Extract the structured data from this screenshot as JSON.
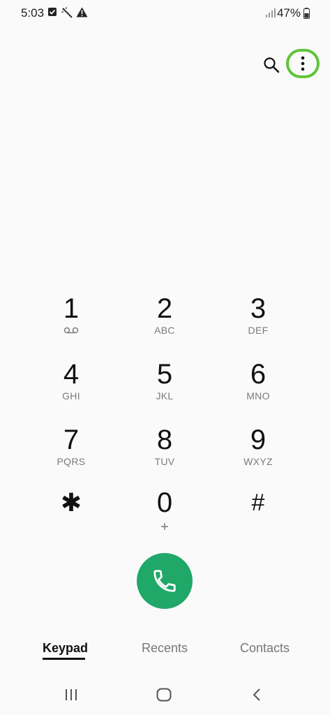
{
  "status_bar": {
    "time": "5:03",
    "battery": "47%",
    "icons": [
      "checkbox-icon",
      "magic-wand-icon",
      "warning-icon",
      "signal-icon",
      "battery-icon"
    ]
  },
  "toolbar": {
    "search_icon": "search-icon",
    "more_icon": "more-options-icon",
    "highlight_color": "#5fc43a"
  },
  "keypad": {
    "keys": [
      {
        "digit": "1",
        "sub": "",
        "sub_icon": "voicemail-icon"
      },
      {
        "digit": "2",
        "sub": "ABC"
      },
      {
        "digit": "3",
        "sub": "DEF"
      },
      {
        "digit": "4",
        "sub": "GHI"
      },
      {
        "digit": "5",
        "sub": "JKL"
      },
      {
        "digit": "6",
        "sub": "MNO"
      },
      {
        "digit": "7",
        "sub": "PQRS"
      },
      {
        "digit": "8",
        "sub": "TUV"
      },
      {
        "digit": "9",
        "sub": "WXYZ"
      },
      {
        "digit": "✱",
        "sub": ""
      },
      {
        "digit": "0",
        "sub": "+"
      },
      {
        "digit": "#",
        "sub": ""
      }
    ]
  },
  "call_button": {
    "icon": "phone-icon",
    "color": "#1fa868"
  },
  "tabs": [
    {
      "label": "Keypad",
      "active": true
    },
    {
      "label": "Recents",
      "active": false
    },
    {
      "label": "Contacts",
      "active": false
    }
  ],
  "nav_bar": {
    "icons": [
      "recent-apps-icon",
      "home-icon",
      "back-icon"
    ]
  }
}
